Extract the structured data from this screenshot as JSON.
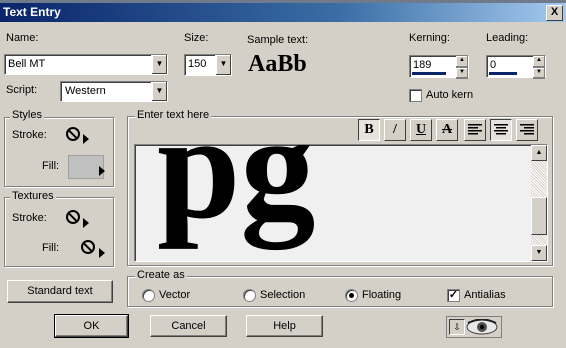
{
  "window": {
    "title": "Text Entry",
    "close_label": "X"
  },
  "font": {
    "label": "Name:",
    "value": "Bell MT"
  },
  "script": {
    "label": "Script:",
    "value": "Western"
  },
  "size": {
    "label": "Size:",
    "value": "150"
  },
  "sample": {
    "label": "Sample text:",
    "text": "AaBb"
  },
  "kerning": {
    "label": "Kerning:",
    "value": "189"
  },
  "leading": {
    "label": "Leading:",
    "value": "0"
  },
  "auto_kern": {
    "label": "Auto kern",
    "checked": false
  },
  "styles": {
    "title": "Styles",
    "stroke_label": "Stroke:",
    "fill_label": "Fill:"
  },
  "textures": {
    "title": "Textures",
    "stroke_label": "Stroke:",
    "fill_label": "Fill:"
  },
  "editor": {
    "title": "Enter text here",
    "content": "pg",
    "format_buttons": [
      {
        "name": "bold-button",
        "label": "B"
      },
      {
        "name": "italic-button",
        "label": "/"
      },
      {
        "name": "underline-button",
        "label": "U"
      },
      {
        "name": "strikethrough-button",
        "label": "A"
      }
    ]
  },
  "create_as": {
    "title": "Create as",
    "options": [
      {
        "name": "vector",
        "label": "Vector",
        "selected": false
      },
      {
        "name": "selection",
        "label": "Selection",
        "selected": false
      },
      {
        "name": "floating",
        "label": "Floating",
        "selected": true
      }
    ],
    "antialias": {
      "label": "Antialias",
      "checked": true
    }
  },
  "buttons": {
    "standard_text": "Standard text",
    "ok": "OK",
    "cancel": "Cancel",
    "help": "Help"
  }
}
